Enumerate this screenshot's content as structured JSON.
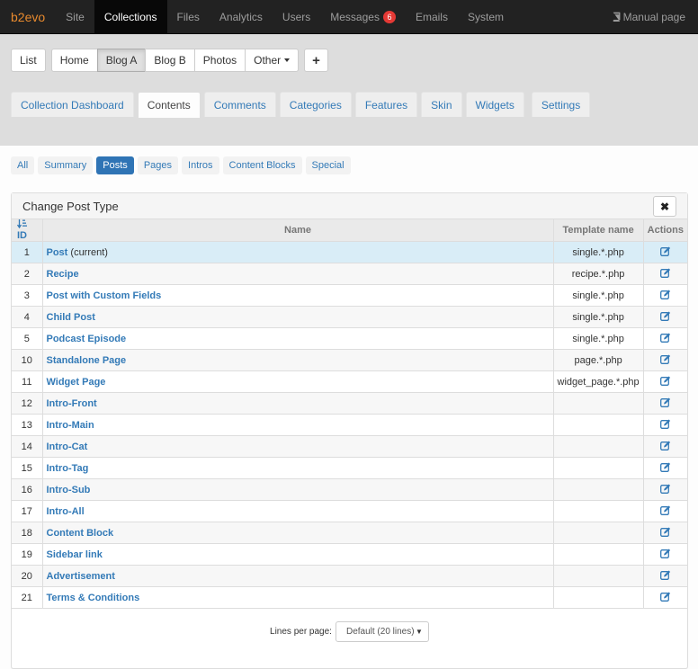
{
  "topnav": {
    "brand": "b2evo",
    "items": [
      {
        "label": "Site",
        "active": false
      },
      {
        "label": "Collections",
        "active": true
      },
      {
        "label": "Files",
        "active": false
      },
      {
        "label": "Analytics",
        "active": false
      },
      {
        "label": "Users",
        "active": false
      },
      {
        "label": "Messages",
        "active": false,
        "badge": "6"
      },
      {
        "label": "Emails",
        "active": false
      },
      {
        "label": "System",
        "active": false
      }
    ],
    "manual": "Manual page"
  },
  "collections": {
    "list_label": "List",
    "items": [
      {
        "label": "Home",
        "active": false
      },
      {
        "label": "Blog A",
        "active": true
      },
      {
        "label": "Blog B",
        "active": false
      },
      {
        "label": "Photos",
        "active": false
      },
      {
        "label": "Other",
        "active": false
      }
    ],
    "add_label": "+"
  },
  "tabs": [
    {
      "label": "Collection Dashboard",
      "active": false
    },
    {
      "label": "Contents",
      "active": true
    },
    {
      "label": "Comments",
      "active": false
    },
    {
      "label": "Categories",
      "active": false
    },
    {
      "label": "Features",
      "active": false
    },
    {
      "label": "Skin",
      "active": false
    },
    {
      "label": "Widgets",
      "active": false
    },
    {
      "label": "Settings",
      "active": false
    }
  ],
  "subtabs": [
    {
      "label": "All",
      "active": false
    },
    {
      "label": "Summary",
      "active": false
    },
    {
      "label": "Posts",
      "active": true
    },
    {
      "label": "Pages",
      "active": false
    },
    {
      "label": "Intros",
      "active": false
    },
    {
      "label": "Content Blocks",
      "active": false
    },
    {
      "label": "Special",
      "active": false
    }
  ],
  "panel": {
    "title": "Change Post Type",
    "close_label": "✖",
    "columns": {
      "id": "ID",
      "name": "Name",
      "template": "Template name",
      "actions": "Actions"
    },
    "rows": [
      {
        "id": "1",
        "name": "Post",
        "suffix": "(current)",
        "template": "single.*.php",
        "current": true
      },
      {
        "id": "2",
        "name": "Recipe",
        "suffix": "",
        "template": "recipe.*.php"
      },
      {
        "id": "3",
        "name": "Post with Custom Fields",
        "suffix": "",
        "template": "single.*.php"
      },
      {
        "id": "4",
        "name": "Child Post",
        "suffix": "",
        "template": "single.*.php"
      },
      {
        "id": "5",
        "name": "Podcast Episode",
        "suffix": "",
        "template": "single.*.php"
      },
      {
        "id": "10",
        "name": "Standalone Page",
        "suffix": "",
        "template": "page.*.php"
      },
      {
        "id": "11",
        "name": "Widget Page",
        "suffix": "",
        "template": "widget_page.*.php"
      },
      {
        "id": "12",
        "name": "Intro-Front",
        "suffix": "",
        "template": ""
      },
      {
        "id": "13",
        "name": "Intro-Main",
        "suffix": "",
        "template": ""
      },
      {
        "id": "14",
        "name": "Intro-Cat",
        "suffix": "",
        "template": ""
      },
      {
        "id": "15",
        "name": "Intro-Tag",
        "suffix": "",
        "template": ""
      },
      {
        "id": "16",
        "name": "Intro-Sub",
        "suffix": "",
        "template": ""
      },
      {
        "id": "17",
        "name": "Intro-All",
        "suffix": "",
        "template": ""
      },
      {
        "id": "18",
        "name": "Content Block",
        "suffix": "",
        "template": ""
      },
      {
        "id": "19",
        "name": "Sidebar link",
        "suffix": "",
        "template": ""
      },
      {
        "id": "20",
        "name": "Advertisement",
        "suffix": "",
        "template": ""
      },
      {
        "id": "21",
        "name": "Terms & Conditions",
        "suffix": "",
        "template": ""
      }
    ],
    "lines_per_page_label": "Lines per page:",
    "lines_per_page_value": "Default (20 lines)"
  },
  "colors": {
    "brand": "#e88a2e",
    "link": "#337ab7",
    "active_pill": "#2f74b5",
    "badge": "#e53935",
    "current_row": "#d9edf7"
  }
}
